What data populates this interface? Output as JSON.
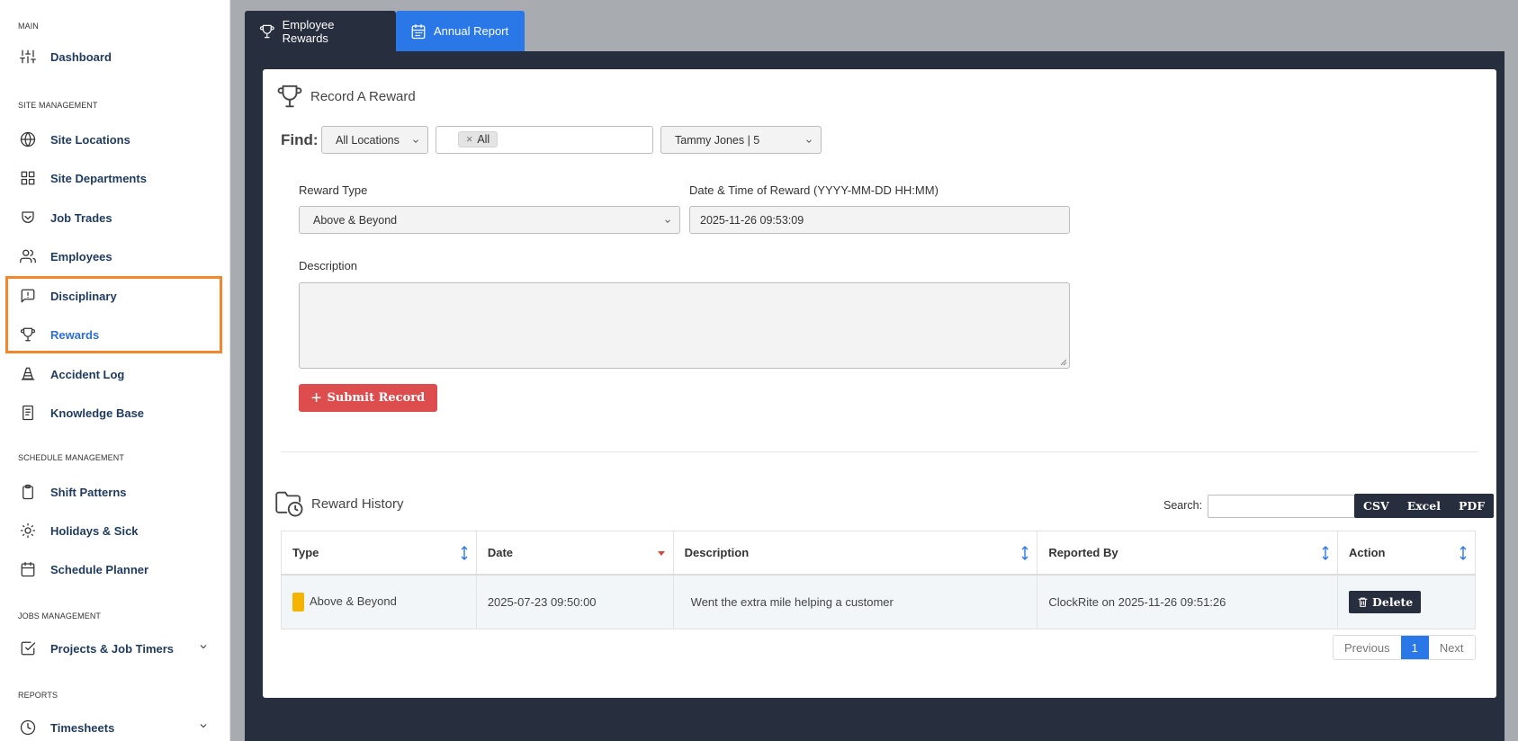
{
  "sidebar": {
    "sections": {
      "main": "MAIN",
      "site": "SITE MANAGEMENT",
      "schedule": "SCHEDULE MANAGEMENT",
      "jobs": "JOBS MANAGEMENT",
      "reports": "REPORTS"
    },
    "items": [
      {
        "label": "Dashboard",
        "icon": "sliders-icon"
      },
      {
        "label": "Site Locations",
        "icon": "globe-icon"
      },
      {
        "label": "Site Departments",
        "icon": "grid-icon"
      },
      {
        "label": "Job Trades",
        "icon": "shield-icon"
      },
      {
        "label": "Employees",
        "icon": "users-icon"
      },
      {
        "label": "Disciplinary",
        "icon": "message-alert-icon"
      },
      {
        "label": "Rewards",
        "icon": "trophy-icon",
        "active": true
      },
      {
        "label": "Accident Log",
        "icon": "cone-icon"
      },
      {
        "label": "Knowledge Base",
        "icon": "book-icon"
      },
      {
        "label": "Shift Patterns",
        "icon": "clipboard-icon"
      },
      {
        "label": "Holidays & Sick",
        "icon": "sun-icon"
      },
      {
        "label": "Schedule Planner",
        "icon": "calendar-icon"
      },
      {
        "label": "Projects & Job Timers",
        "icon": "check-square-icon"
      },
      {
        "label": "Timesheets",
        "icon": "clock-icon"
      }
    ]
  },
  "tabs": [
    {
      "label": "Employee Rewards",
      "active": true
    },
    {
      "label": "Annual Report",
      "active": false
    }
  ],
  "record": {
    "title": "Record A Reward",
    "find_label": "Find:",
    "location_select": "All Locations",
    "chip_remove": "×",
    "chip_label": "All",
    "employee_select": "Tammy Jones | 5",
    "reward_type_label": "Reward Type",
    "reward_type_value": "Above & Beyond",
    "datetime_label": "Date & Time of Reward (YYYY-MM-DD HH:MM)",
    "datetime_value": "2025-11-26 09:53:09",
    "description_label": "Description",
    "description_value": "",
    "submit_label": "Submit Record"
  },
  "history": {
    "title": "Reward History",
    "search_label": "Search:",
    "search_value": "",
    "export_buttons": [
      "CSV",
      "Excel",
      "PDF"
    ],
    "columns": [
      "Type",
      "Date",
      "Description",
      "Reported By",
      "Action"
    ],
    "rows": [
      {
        "type": "Above & Beyond",
        "badge_color": "#f5b400",
        "date": "2025-07-23 09:50:00",
        "description": "Went the extra mile helping a customer",
        "reported_by": "ClockRite on 2025-11-26 09:51:26",
        "action": "Delete"
      }
    ],
    "pagination": {
      "previous": "Previous",
      "current": "1",
      "next": "Next"
    }
  },
  "colors": {
    "accent": "#2a77e8",
    "danger": "#de4d4d",
    "dark": "#272e3d",
    "highlight": "#f5862c"
  }
}
